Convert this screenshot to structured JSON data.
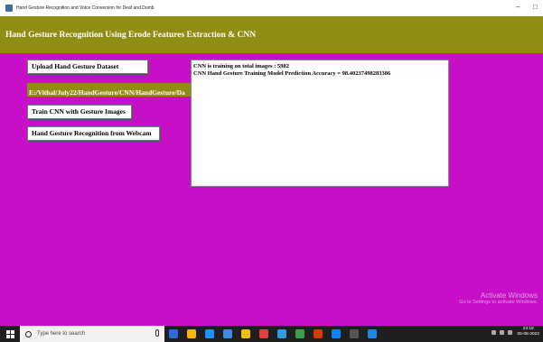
{
  "window": {
    "title": "Hand Gesture Recognition and Voice Conversion for Deaf and Dumb",
    "minimize": "–",
    "maximize": "□"
  },
  "header": {
    "title": "Hand Gesture Recognition Using Erode Features Extraction & CNN"
  },
  "buttons": {
    "upload": "Upload Hand Gesture Dataset",
    "train": "Train CNN with Gesture Images",
    "webcam": "Hand Gesture Recognition from Webcam"
  },
  "dataset_path": "E:/Vithal/July22/HandGesture/CNN/HandGesture/Da",
  "output": {
    "line1": "CNN is training on total images : 5982",
    "line2": "CNN Hand Gesture Training Model Prediction Accuracy = 98.40237498283386"
  },
  "watermark": {
    "line1": "Activate Windows",
    "line2": "Go to Settings to activate Windows."
  },
  "taskbar": {
    "search_placeholder": "Type here to search",
    "time": "23:18",
    "date": "05-08-2022",
    "icon_colors": [
      "#2b6fd6",
      "#ffb400",
      "#1e90ff",
      "#3c8dde",
      "#f0c000",
      "#e04040",
      "#2f9be0",
      "#3aa04a",
      "#d83b01",
      "#0a84ff",
      "#555555",
      "#1e88e5"
    ]
  },
  "colors": {
    "background": "#c80fc8",
    "header": "#8e8e12"
  }
}
